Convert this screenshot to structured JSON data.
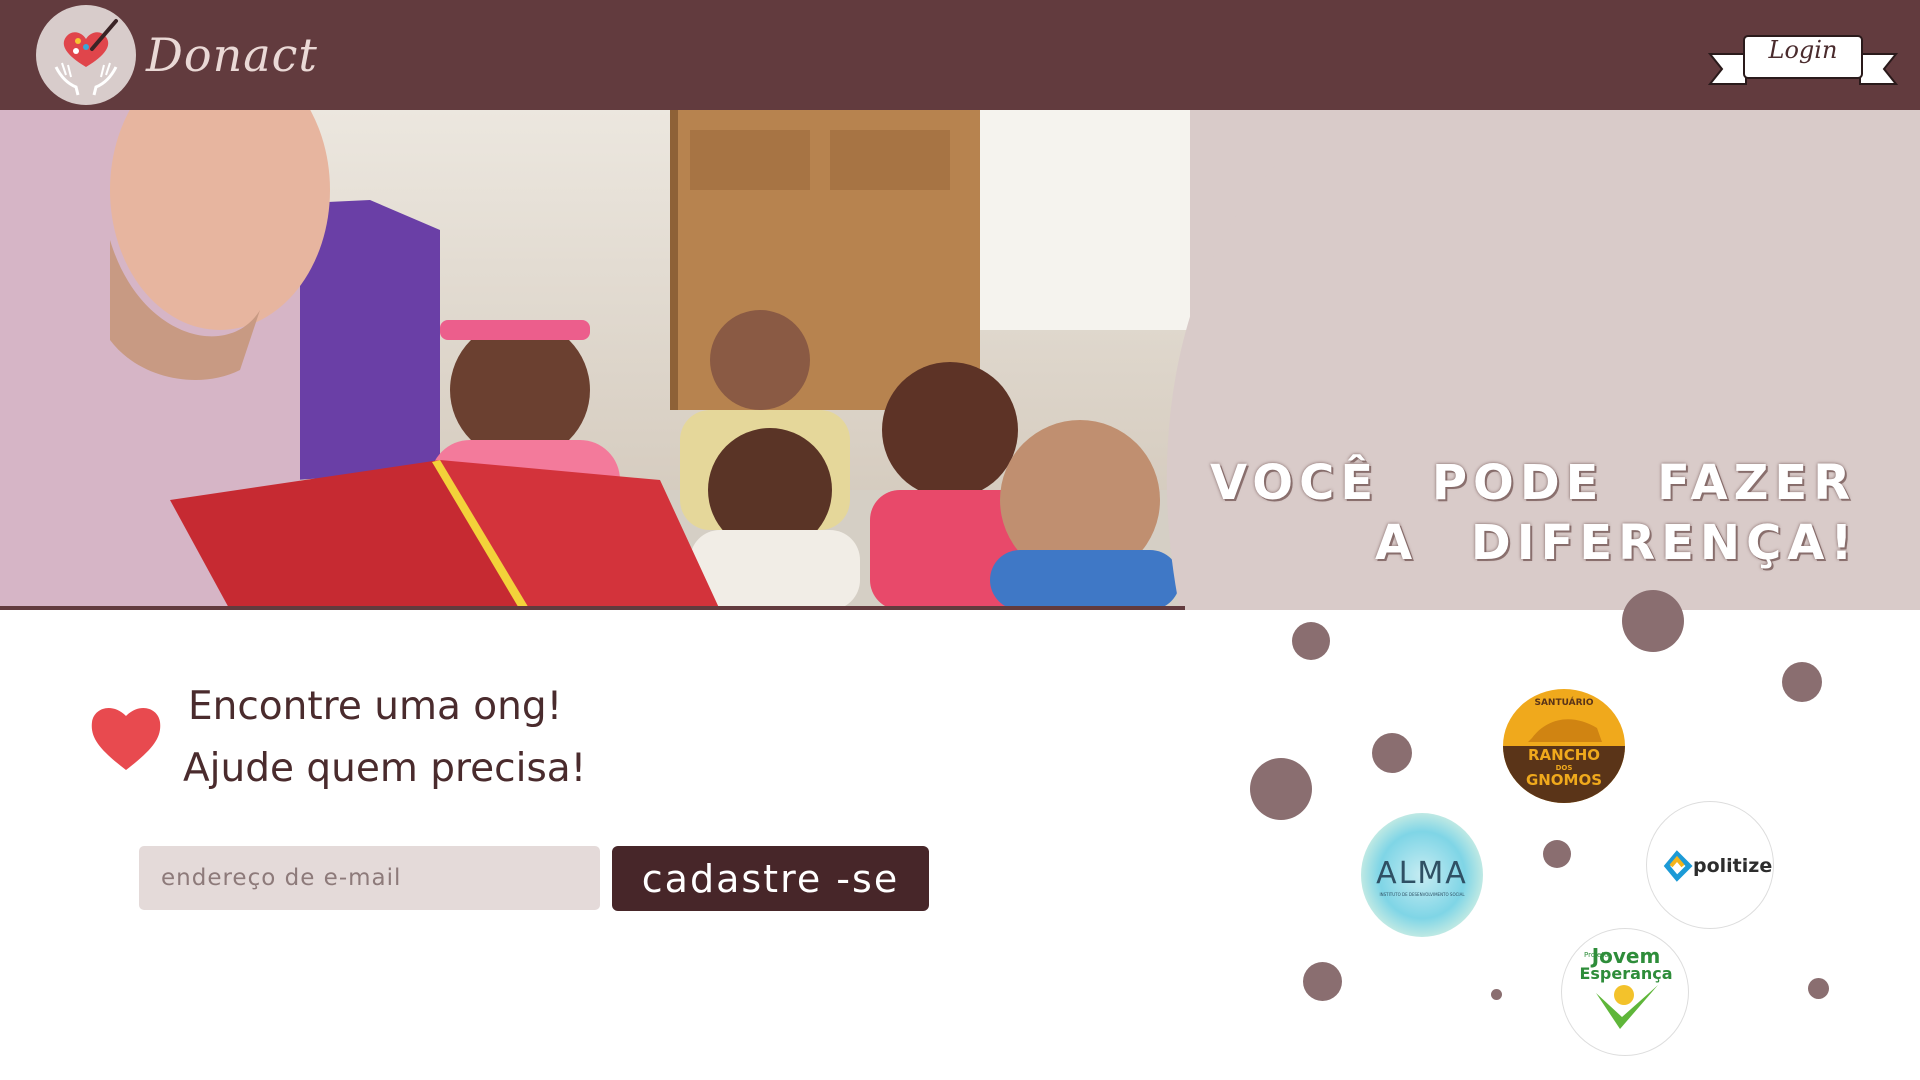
{
  "header": {
    "logo_text": "Donact",
    "login_label": "Login"
  },
  "hero": {
    "slogan_line1": "VOCÊ PODE FAZER",
    "slogan_line2": "A DIFERENÇA!"
  },
  "signup": {
    "tagline_line1": "Encontre uma ong!",
    "tagline_line2": "Ajude quem precisa!",
    "email_placeholder": "endereço de e-mail",
    "email_value": "",
    "button_label": "cadastre -se"
  },
  "partners": {
    "rancho": {
      "top": "SANTUÁRIO",
      "line1": "RANCHO",
      "line2": "DOS",
      "line3": "GNOMOS"
    },
    "alma": {
      "name": "ALMA",
      "subtitle": "INSTITUTO DE DESENVOLVIMENTO SOCIAL"
    },
    "politize": {
      "name": "politize!"
    },
    "jovem": {
      "small": "Projeto",
      "line1": "Jovem",
      "line2": "Esperança"
    }
  },
  "colors": {
    "header_bg": "#623b3e",
    "panel_bg": "#d9cbc9",
    "button_bg": "#472629",
    "heart": "#e84a4f",
    "dot": "#8a6e70"
  },
  "icons": [
    "logo-heart-brush-hands-icon",
    "login-ribbon-icon",
    "heart-icon"
  ]
}
